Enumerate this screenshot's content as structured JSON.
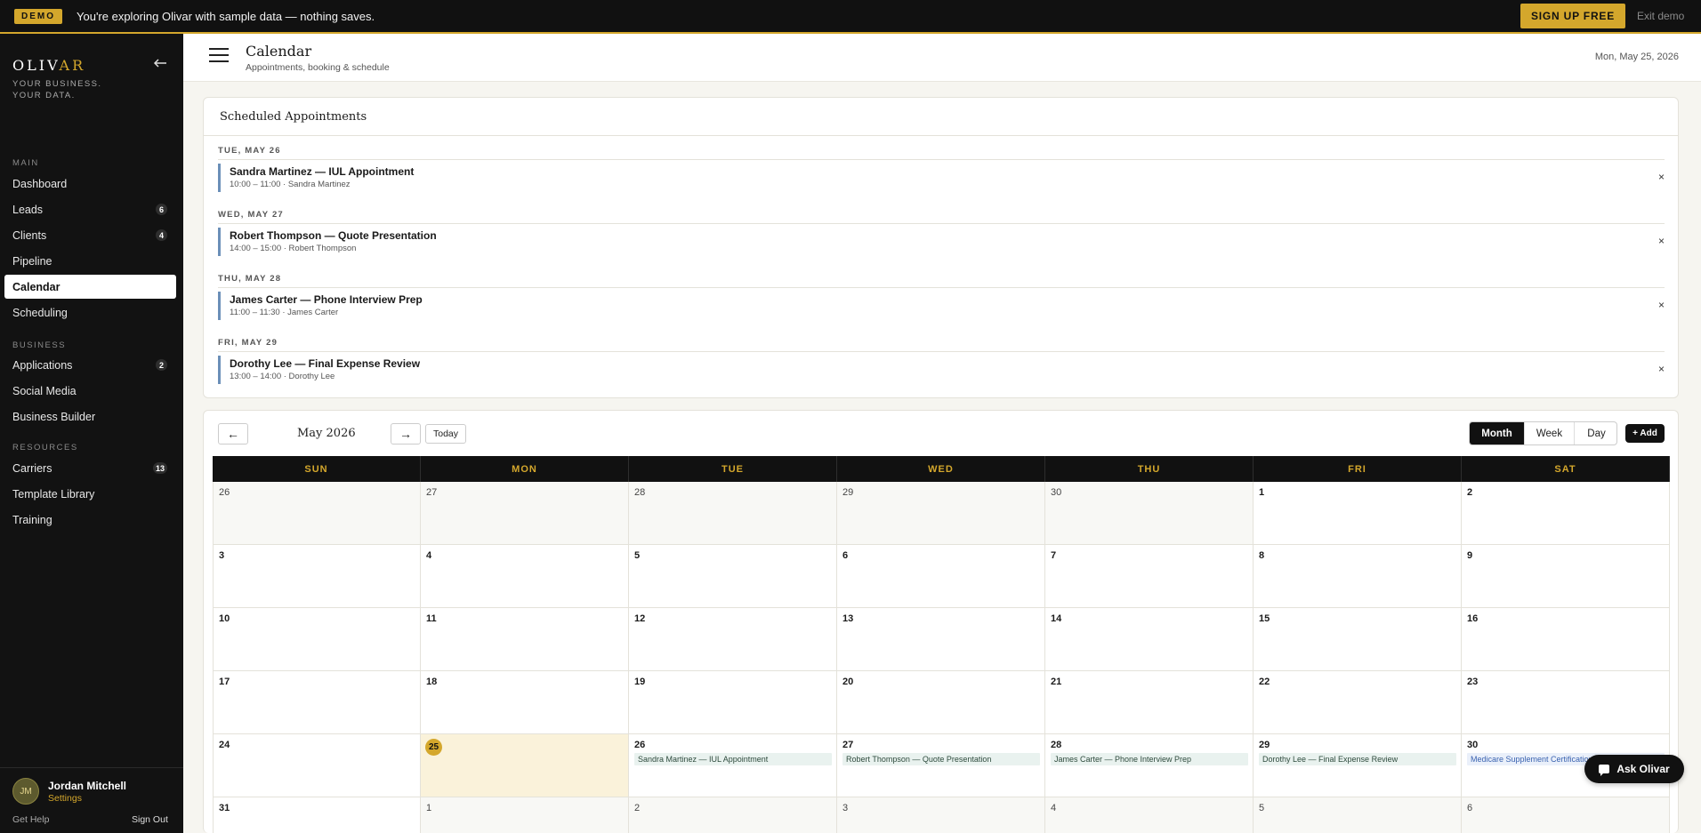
{
  "banner": {
    "badge": "DEMO",
    "message": "You're exploring Olivar with sample data — nothing saves.",
    "signup_label": "SIGN UP FREE",
    "exit_label": "Exit demo",
    "accent_color": "#d4a72c"
  },
  "sidebar": {
    "brand_main": "OLIV",
    "brand_accent": "AR",
    "tagline": "YOUR BUSINESS. YOUR DATA.",
    "collapse_icon": "arrow-left-icon",
    "sections": [
      {
        "title": "MAIN",
        "items": [
          {
            "label": "Dashboard",
            "count": null
          },
          {
            "label": "Leads",
            "count": "6"
          },
          {
            "label": "Clients",
            "count": "4"
          },
          {
            "label": "Pipeline",
            "count": null
          },
          {
            "label": "Calendar",
            "count": null,
            "active": true
          },
          {
            "label": "Scheduling",
            "count": null
          }
        ]
      },
      {
        "title": "BUSINESS",
        "items": [
          {
            "label": "Applications",
            "count": "2"
          },
          {
            "label": "Social Media",
            "count": null
          },
          {
            "label": "Business Builder",
            "count": null
          }
        ]
      },
      {
        "title": "RESOURCES",
        "items": [
          {
            "label": "Carriers",
            "count": "13"
          },
          {
            "label": "Template Library",
            "count": null
          },
          {
            "label": "Training",
            "count": null
          }
        ]
      }
    ],
    "user": {
      "initials": "JM",
      "name": "Jordan Mitchell",
      "settings_label": "Settings"
    },
    "get_help": "Get Help",
    "sign_out": "Sign Out"
  },
  "header": {
    "title": "Calendar",
    "subtitle": "Appointments, booking & schedule",
    "date": "Mon, May 25, 2026"
  },
  "appointments": {
    "title": "Scheduled Appointments",
    "groups": [
      {
        "day": "TUE, MAY 26",
        "title": "Sandra Martinez — IUL Appointment",
        "detail": "10:00 – 11:00 · Sandra Martinez"
      },
      {
        "day": "WED, MAY 27",
        "title": "Robert Thompson — Quote Presentation",
        "detail": "14:00 – 15:00 · Robert Thompson"
      },
      {
        "day": "THU, MAY 28",
        "title": "James Carter — Phone Interview Prep",
        "detail": "11:00 – 11:30 · James Carter"
      },
      {
        "day": "FRI, MAY 29",
        "title": "Dorothy Lee — Final Expense Review",
        "detail": "13:00 – 14:00 · Dorothy Lee"
      }
    ],
    "remove_symbol": "×"
  },
  "calendar": {
    "month_label": "May 2026",
    "prev_symbol": "←",
    "next_symbol": "→",
    "today_label": "Today",
    "views": [
      "Month",
      "Week",
      "Day"
    ],
    "active_view": "Month",
    "add_label": "+ Add",
    "weekdays": [
      "SUN",
      "MON",
      "TUE",
      "WED",
      "THU",
      "FRI",
      "SAT"
    ],
    "weeks": [
      [
        {
          "n": "26",
          "other": true
        },
        {
          "n": "27",
          "other": true
        },
        {
          "n": "28",
          "other": true
        },
        {
          "n": "29",
          "other": true
        },
        {
          "n": "30",
          "other": true
        },
        {
          "n": "1"
        },
        {
          "n": "2"
        }
      ],
      [
        {
          "n": "3"
        },
        {
          "n": "4"
        },
        {
          "n": "5"
        },
        {
          "n": "6"
        },
        {
          "n": "7"
        },
        {
          "n": "8"
        },
        {
          "n": "9"
        }
      ],
      [
        {
          "n": "10"
        },
        {
          "n": "11"
        },
        {
          "n": "12"
        },
        {
          "n": "13"
        },
        {
          "n": "14"
        },
        {
          "n": "15"
        },
        {
          "n": "16"
        }
      ],
      [
        {
          "n": "17"
        },
        {
          "n": "18"
        },
        {
          "n": "19"
        },
        {
          "n": "20"
        },
        {
          "n": "21"
        },
        {
          "n": "22"
        },
        {
          "n": "23"
        }
      ],
      [
        {
          "n": "24"
        },
        {
          "n": "25",
          "today": true
        },
        {
          "n": "26",
          "event": "Sandra Martinez — IUL Appointment"
        },
        {
          "n": "27",
          "event": "Robert Thompson — Quote Presentation"
        },
        {
          "n": "28",
          "event": "James Carter — Phone Interview Prep"
        },
        {
          "n": "29",
          "event": "Dorothy Lee — Final Expense Review"
        },
        {
          "n": "30",
          "event": "Medicare Supplement Certification",
          "event_color": "blue"
        }
      ],
      [
        {
          "n": "31"
        },
        {
          "n": "1",
          "other": true
        },
        {
          "n": "2",
          "other": true
        },
        {
          "n": "3",
          "other": true
        },
        {
          "n": "4",
          "other": true
        },
        {
          "n": "5",
          "other": true
        },
        {
          "n": "6",
          "other": true
        }
      ]
    ]
  },
  "ask_button": {
    "label": "Ask Olivar",
    "icon": "chat-icon"
  }
}
